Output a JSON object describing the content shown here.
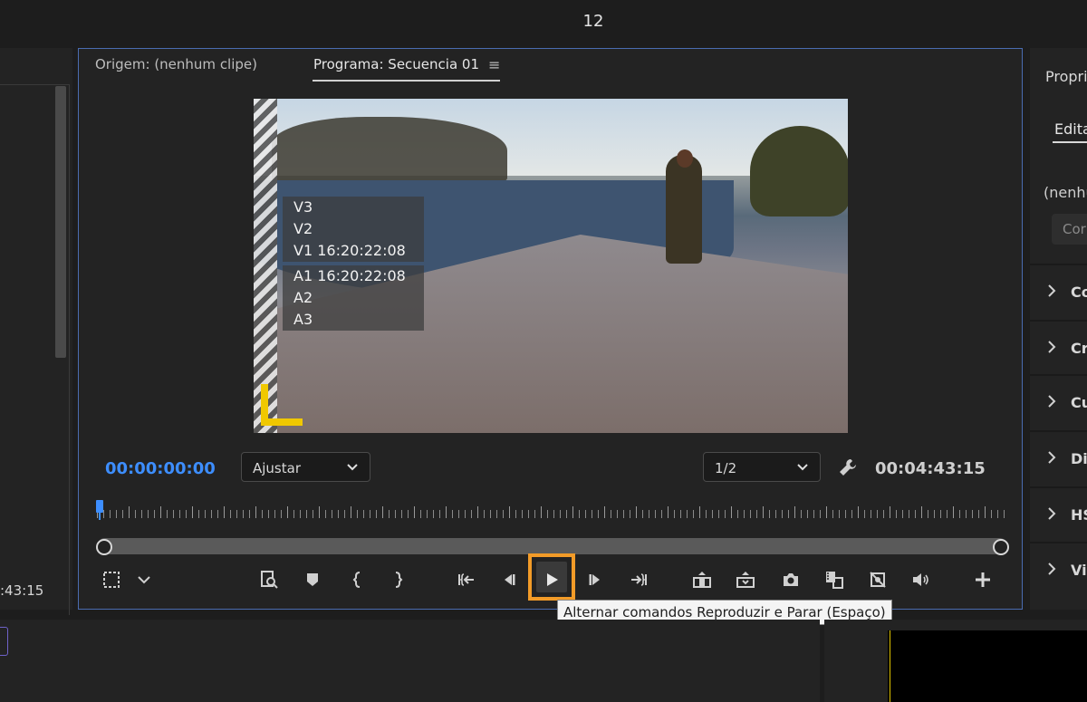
{
  "window": {
    "title": "12"
  },
  "left_panel": {
    "timecode": ":43:15"
  },
  "monitor": {
    "tabs": [
      {
        "label": "Origem: (nenhum clipe)"
      },
      {
        "label": "Programa: Secuencia 01"
      }
    ],
    "tab_menu_glyph": "≡",
    "overlay": {
      "video_tracks": [
        "V3",
        "V2",
        "V1 16:20:22:08"
      ],
      "audio_tracks": [
        "A1 16:20:22:08",
        "A2",
        "A3"
      ]
    },
    "current_timecode": "00:00:00:00",
    "zoom_select": {
      "value": "Ajustar"
    },
    "resolution_select": {
      "value": "1/2"
    },
    "duration_timecode": "00:04:43:15",
    "playhead_position": 0,
    "controls": [
      "marker-selection-icon",
      "chevron-down-icon",
      "zoom-fit-icon",
      "add-marker-icon",
      "mark-in-icon",
      "mark-out-icon",
      "go-to-in-icon",
      "step-back-icon",
      "play-icon",
      "step-forward-icon",
      "go-to-out-icon",
      "lift-icon",
      "extract-icon",
      "export-frame-icon",
      "comparison-view-icon",
      "toggle-proxies-icon",
      "audio-volume-icon",
      "add-button-icon"
    ],
    "tooltip": "Alternar comandos Reproduzir e Parar (Espaço)"
  },
  "right_panel": {
    "header": "Propri",
    "subtab": "Edita",
    "none_label": "(nenhu",
    "button_label": "Cor",
    "sections": [
      "Co",
      "Cri",
      "Cu",
      "Dis",
      "HS",
      "Vir"
    ]
  },
  "colors": {
    "accent_blue": "#3d8eff",
    "highlight_orange": "#f29b28",
    "safe_margin_yellow": "#f0c800",
    "panel_border_blue": "#4a6cb0"
  }
}
